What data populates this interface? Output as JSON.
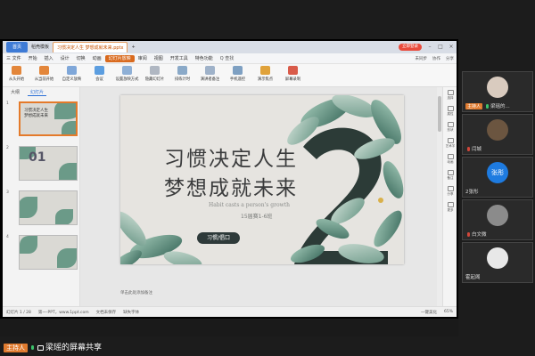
{
  "wps": {
    "tabs": [
      "首页",
      "稻壳模板",
      "习惯决定人生 梦想成就未来.pptx"
    ],
    "login_label": "立即登录",
    "menu": [
      "三 文件",
      "开始",
      "插入",
      "设计",
      "切换",
      "动画",
      "幻灯片放映",
      "审阅",
      "视图",
      "开发工具",
      "特色功能"
    ],
    "active_menu_index": 6,
    "search_label": "Q 查找",
    "menu_right": [
      "未同步",
      "协作",
      "分享"
    ],
    "ribbon": [
      "从头开始",
      "从当前开始",
      "自定义放映",
      "会议",
      "设置放映方式",
      "隐藏幻灯片",
      "排练计时",
      "演讲者备注",
      "手机遥控",
      "演示焦点",
      "屏幕录制"
    ],
    "pane_tabs": [
      "大纲",
      "幻灯片"
    ],
    "thumbnails": [
      {
        "num": "1",
        "text": "习惯决定人生\n梦想成就未来"
      },
      {
        "num": "2",
        "text": "01"
      },
      {
        "num": "3",
        "text": ""
      },
      {
        "num": "4",
        "text": ""
      }
    ],
    "right_tools": [
      "选择",
      "属性",
      "形状",
      "艺术字",
      "动画",
      "备注",
      "分享",
      "更多"
    ],
    "notes_placeholder": "单击此处添加备注",
    "status": {
      "slide_info": "幻灯片 1 / 28",
      "theme": "第一-PPT，www.1ppt.com",
      "doc_status": "文档未保存",
      "font_missing": "缺失字体",
      "beautify": "一键美化",
      "zoom": "65%"
    }
  },
  "slide": {
    "title_line1": "习惯决定人生",
    "title_line2": "梦想成就未来",
    "subtitle": "Habit casts a person's growth",
    "class_name": "15届赛1-6班",
    "badge": "习惯/倡口"
  },
  "participants": [
    {
      "name": "梁瑶的...",
      "role": "主持人",
      "avatar_color": "#d9cbbf"
    },
    {
      "name": "闫城",
      "role": "",
      "avatar_color": "#6b5540"
    },
    {
      "name": "2张彤",
      "role": "",
      "avatar_color": "#1e7be0",
      "avatar_text": "张彤"
    },
    {
      "name": "白文微",
      "role": "",
      "avatar_color": "#8b8b8b"
    },
    {
      "name": "霍起阁",
      "role": "",
      "avatar_color": "#e8e8e8"
    }
  ],
  "share_bar": {
    "host_badge": "主持人",
    "text": "梁瑶的屏幕共享"
  },
  "colors": {
    "accent": "#d96a1e",
    "host": "#e07b2f",
    "leaf": "#6b9a88"
  }
}
